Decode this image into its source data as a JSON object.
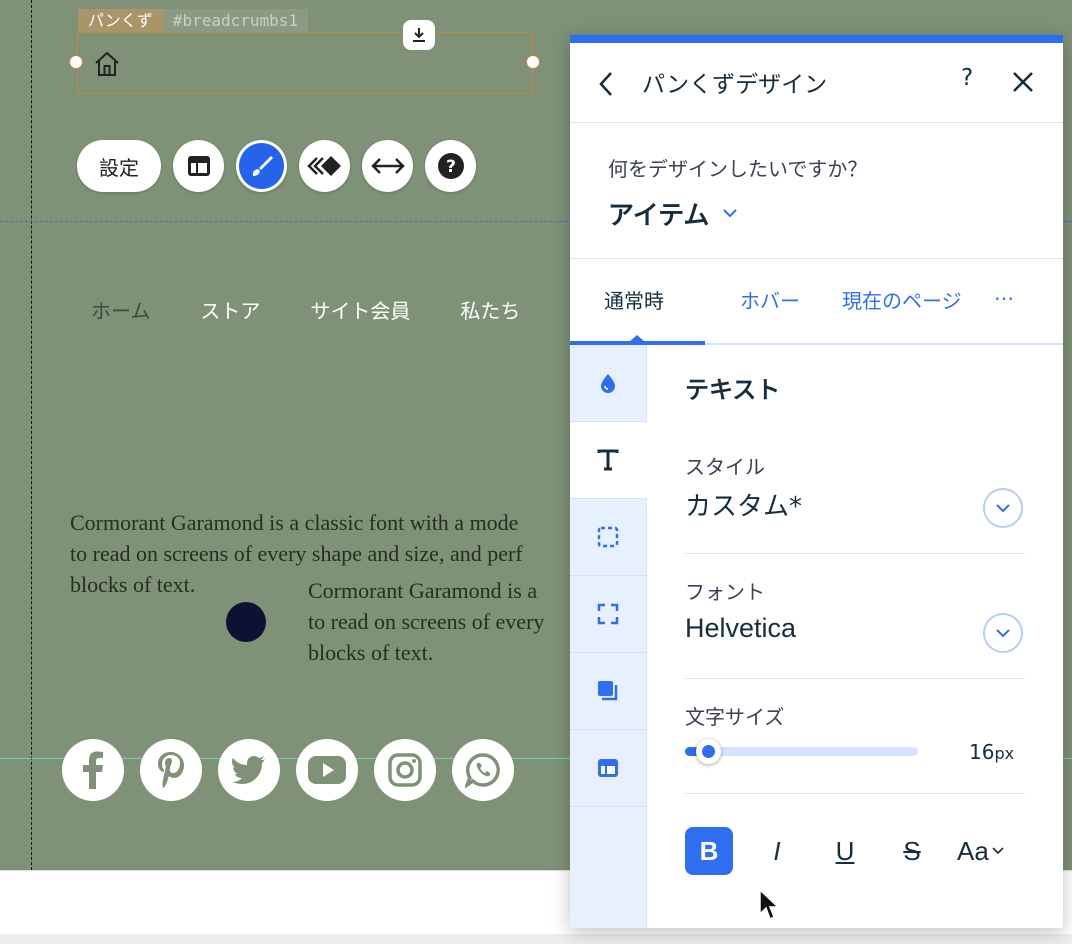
{
  "canvas": {
    "breadcrumb_tag": "パンくず",
    "breadcrumb_id": "#breadcrumbs1",
    "toolbar": {
      "settings_label": "設定"
    },
    "nav_items": [
      "ホーム",
      "ストア",
      "サイト会員",
      "私たち"
    ],
    "paragraph1": [
      "Cormorant Garamond is a classic font with a mode",
      "to read on screens of every shape and size, and perf",
      "blocks of text."
    ],
    "paragraph2": [
      "Cormorant Garamond is a",
      "to read on screens of every",
      "blocks of text."
    ],
    "social_icons": [
      "facebook-icon",
      "pinterest-icon",
      "twitter-icon",
      "youtube-icon",
      "instagram-icon",
      "whatsapp-icon"
    ]
  },
  "panel": {
    "title": "パンくずデザイン",
    "help": "?",
    "question": "何をデザインしたいですか？",
    "selected_item": "アイテム",
    "tabs": {
      "normal": "通常時",
      "hover": "ホバー",
      "current": "現在のページ",
      "more": "…"
    },
    "section_title": "テキスト",
    "style": {
      "label": "スタイル",
      "value": "カスタム*"
    },
    "font": {
      "label": "フォント",
      "value": "Helvetica"
    },
    "size": {
      "label": "文字サイズ",
      "value": "16",
      "unit": "px",
      "fraction": 0.04
    },
    "format": {
      "bold": "B",
      "italic": "I",
      "underline": "U",
      "strike": "S",
      "case": "Aa"
    }
  },
  "colors": {
    "accent": "#2e6ff2",
    "canvas_bg": "#7f9278",
    "selection": "#c9834a"
  }
}
